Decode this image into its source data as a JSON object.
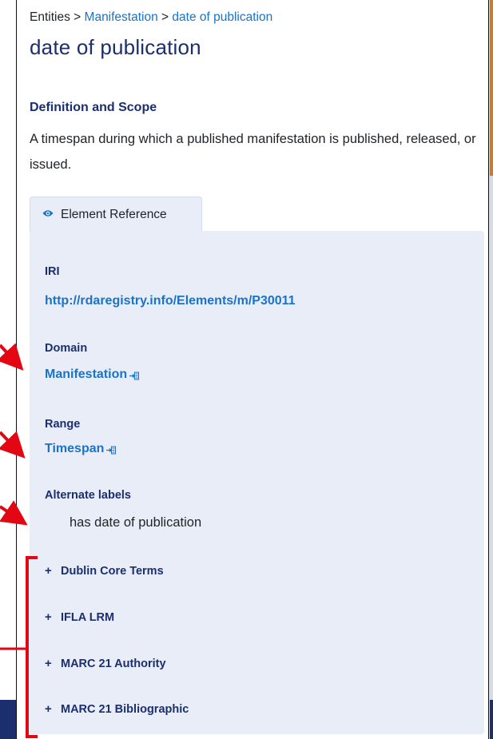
{
  "breadcrumb": {
    "root": "Entities",
    "sep1": ">",
    "parent": "Manifestation",
    "sep2": ">",
    "current": "date of publication"
  },
  "page_title": "date of publication",
  "definition": {
    "heading": "Definition and Scope",
    "text": "A timespan during which a published manifestation is published, released, or issued."
  },
  "tab": {
    "label": "Element Reference",
    "icon": "eye-icon"
  },
  "element_reference": {
    "iri_label": "IRI",
    "iri_value": "http://rdaregistry.info/Elements/m/P30011",
    "domain_label": "Domain",
    "domain_value": "Manifestation",
    "range_label": "Range",
    "range_value": "Timespan",
    "alt_labels_label": "Alternate labels",
    "alt_labels_value": "has date of publication"
  },
  "accordion": [
    {
      "symbol": "+",
      "label": "Dublin Core Terms"
    },
    {
      "symbol": "+",
      "label": "IFLA LRM"
    },
    {
      "symbol": "+",
      "label": "MARC 21 Authority"
    },
    {
      "symbol": "+",
      "label": "MARC 21 Bibliographic"
    }
  ],
  "colors": {
    "heading_navy": "#1b2f6e",
    "link_blue": "#1a73c8",
    "panel_bg": "#e8edf7",
    "annotation_red": "#e30613"
  }
}
